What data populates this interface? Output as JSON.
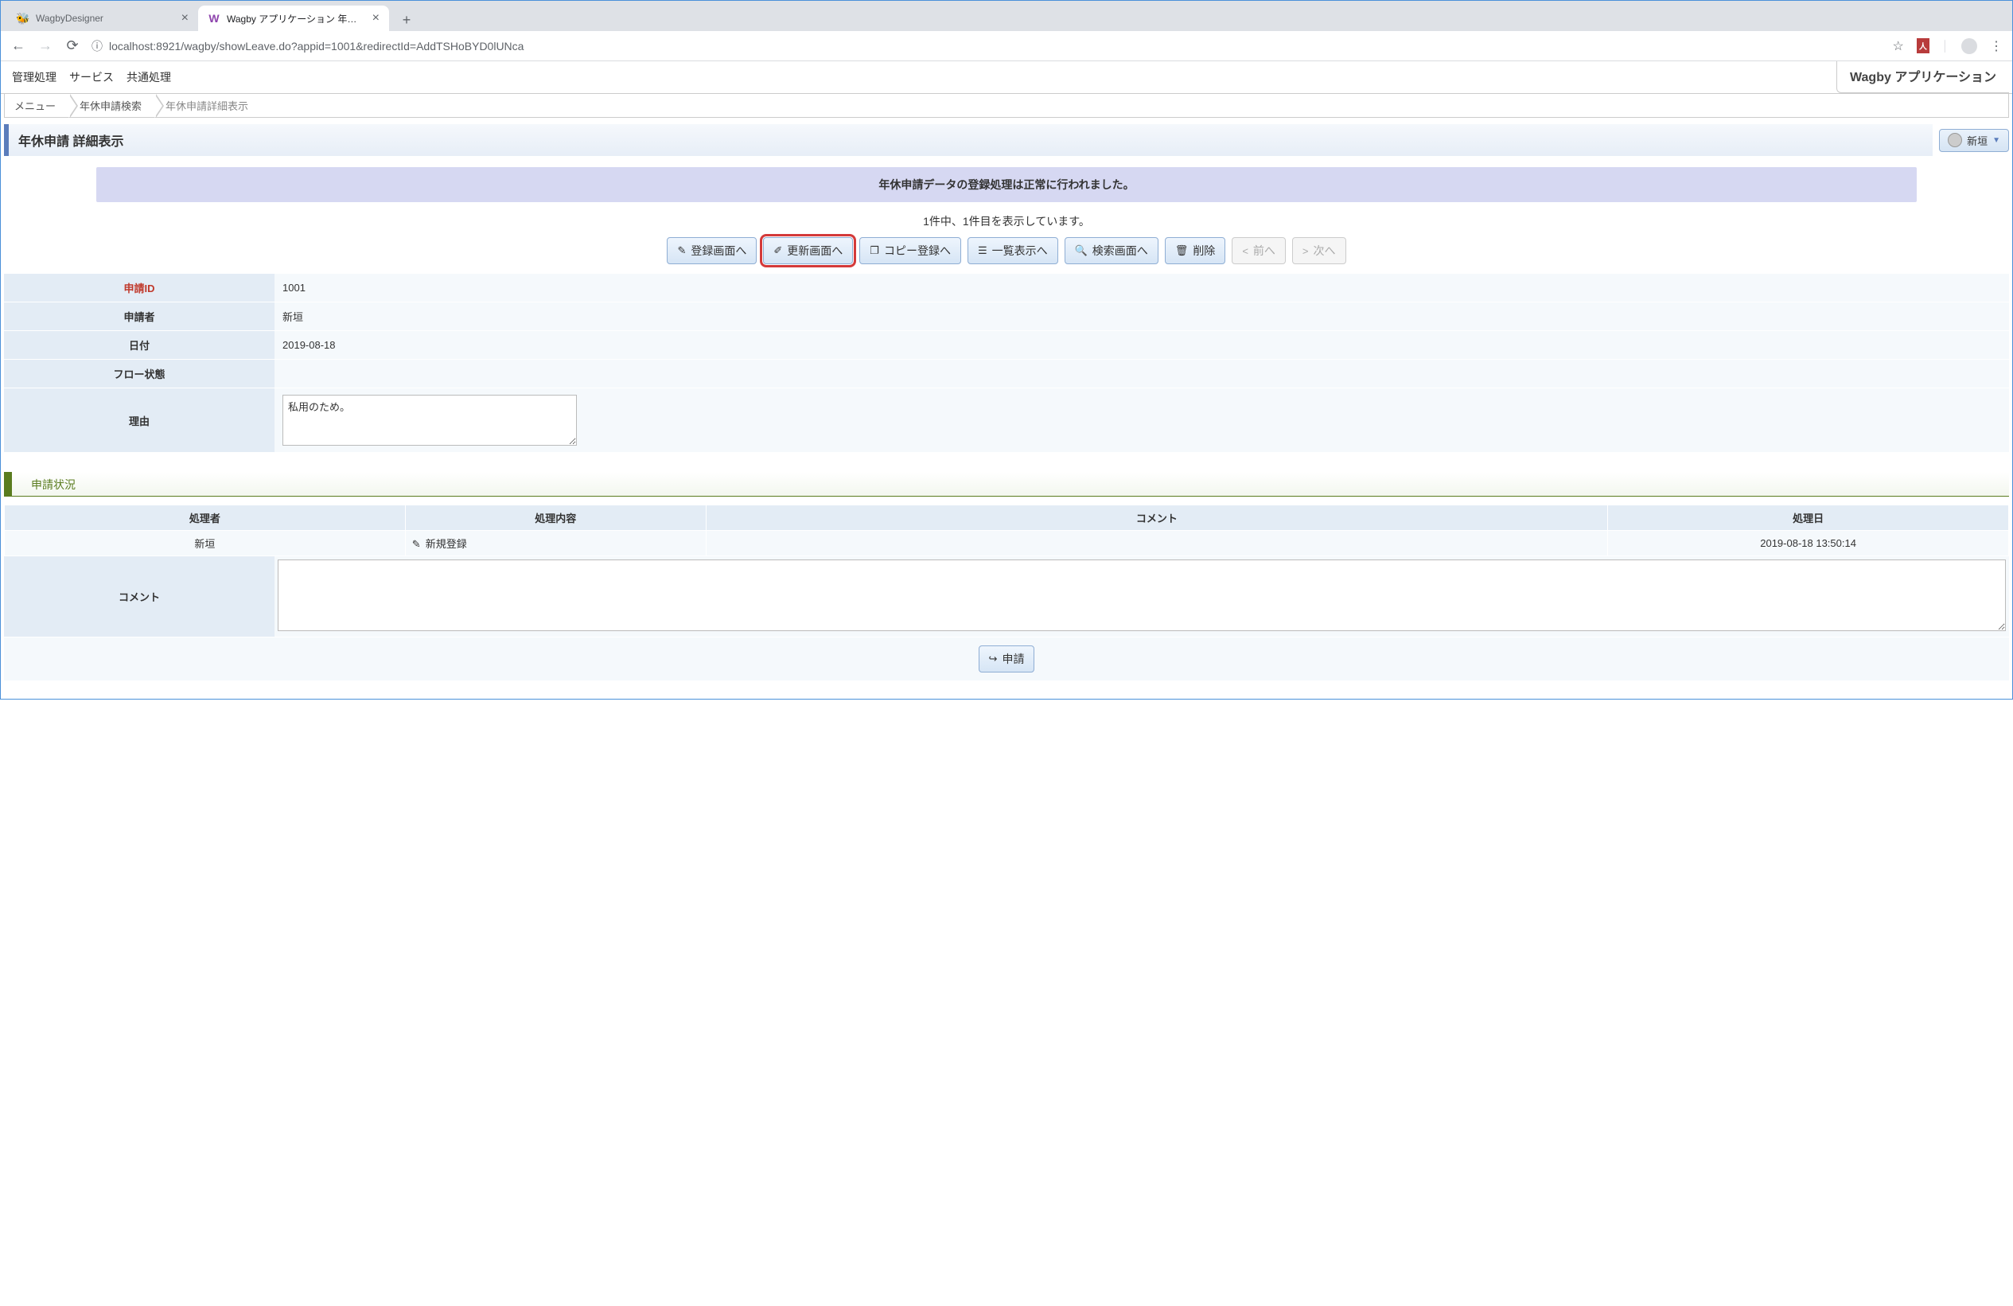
{
  "browser": {
    "tabs": [
      {
        "title": "WagbyDesigner",
        "active": false,
        "favicon": "🐝"
      },
      {
        "title": "Wagby アプリケーション 年休申請詳",
        "active": true,
        "favicon": "W"
      }
    ],
    "url_info_icon": "ⓘ",
    "url_host": "localhost",
    "url_port_path": ":8921/wagby/showLeave.do?appid=1001&redirectId=AddTSHoBYD0lUNca",
    "pdf_badge": "人"
  },
  "menubar": {
    "items": [
      "管理処理",
      "サービス",
      "共通処理"
    ]
  },
  "app_title": "Wagby アプリケーション",
  "breadcrumb": [
    "メニュー",
    "年休申請検索",
    "年休申請詳細表示"
  ],
  "page_title": "年休申請 詳細表示",
  "user": {
    "name": "新垣"
  },
  "message": "年休申請データの登録処理は正常に行われました。",
  "record_info": "1件中、1件目を表示しています。",
  "actions": {
    "register": "登録画面へ",
    "update": "更新画面へ",
    "copy": "コピー登録へ",
    "list": "一覧表示へ",
    "search": "検索画面へ",
    "delete": "削除",
    "prev": "前へ",
    "next": "次へ"
  },
  "detail": {
    "labels": {
      "id": "申請ID",
      "applicant": "申請者",
      "date": "日付",
      "flow": "フロー状態",
      "reason": "理由"
    },
    "values": {
      "id": "1001",
      "applicant": "新垣",
      "date": "2019-08-18",
      "flow": "",
      "reason": "私用のため。"
    }
  },
  "section_status_title": "申請状況",
  "status_table": {
    "headers": {
      "user": "処理者",
      "action": "処理内容",
      "comment": "コメント",
      "date": "処理日"
    },
    "rows": [
      {
        "user": "新垣",
        "action": "新規登録",
        "comment": "",
        "date": "2019-08-18 13:50:14"
      }
    ]
  },
  "comment_label": "コメント",
  "submit_button": "申請"
}
